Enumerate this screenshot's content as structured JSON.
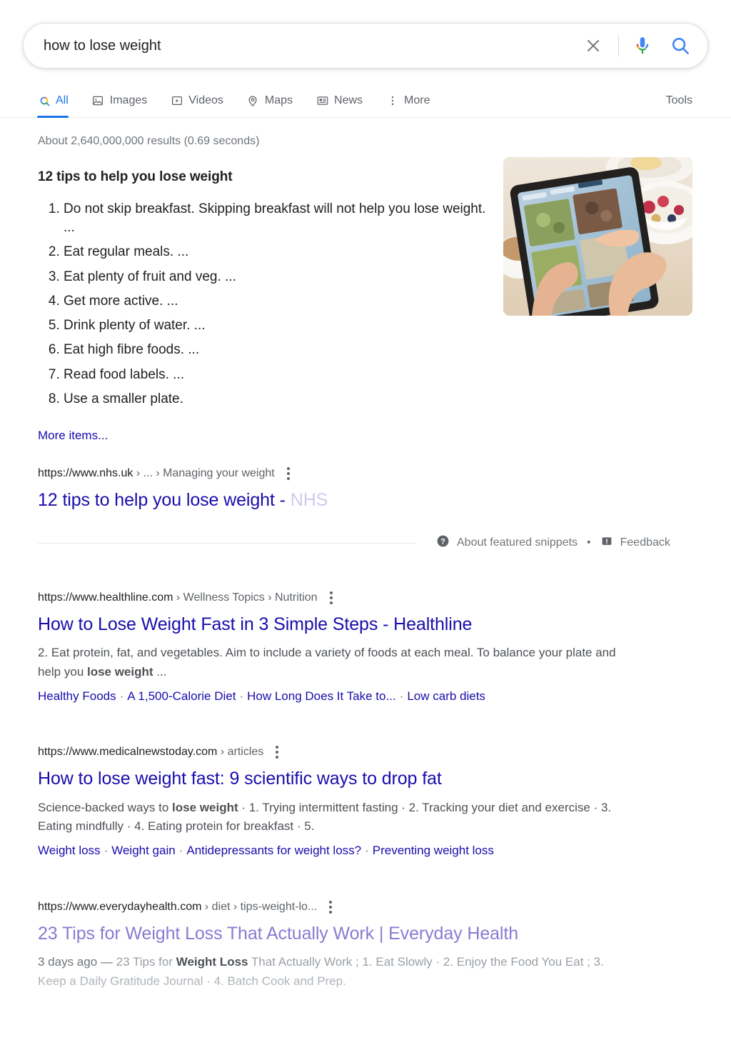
{
  "search": {
    "query": "how to lose weight",
    "placeholder": "Search",
    "clear_label": "Clear",
    "mic_label": "Search by voice",
    "search_label": "Google Search"
  },
  "nav": {
    "tabs": [
      {
        "label": "All",
        "icon": "google-search-icon",
        "active": true
      },
      {
        "label": "Images",
        "icon": "image-icon",
        "active": false
      },
      {
        "label": "Videos",
        "icon": "video-icon",
        "active": false
      },
      {
        "label": "Maps",
        "icon": "map-pin-icon",
        "active": false
      },
      {
        "label": "News",
        "icon": "news-icon",
        "active": false
      },
      {
        "label": "More",
        "icon": "kebab-icon",
        "active": false
      }
    ],
    "tools_label": "Tools"
  },
  "result_stats": "About 2,640,000,000 results (0.69 seconds)",
  "featured_snippet": {
    "heading": "12 tips to help you lose weight",
    "items": [
      "Do not skip breakfast. Skipping breakfast will not help you lose weight. ...",
      "Eat regular meals. ...",
      "Eat plenty of fruit and veg. ...",
      "Get more active. ...",
      "Drink plenty of water. ...",
      "Eat high fibre foods. ...",
      "Read food labels. ...",
      "Use a smaller plate."
    ],
    "more_items_label": "More items...",
    "source": {
      "domain": "https://www.nhs.uk",
      "crumbs": "› ... › Managing your weight",
      "title_visible": "12 tips to help you lose weight - ",
      "title_faded": "NHS"
    },
    "thumbnail_alt": "hands-using-tablet-with-meal-photos",
    "footer": {
      "about_label": "About featured snippets",
      "separator": "•",
      "feedback_label": "Feedback"
    }
  },
  "results": [
    {
      "domain": "https://www.healthline.com",
      "crumbs": "› Wellness Topics › Nutrition",
      "title": "How to Lose Weight Fast in 3 Simple Steps - Healthline",
      "snippet_pre": "2. Eat protein, fat, and vegetables. Aim to include a variety of foods at each meal. To balance your plate and help you ",
      "snippet_bold": "lose weight",
      "snippet_post": " ...",
      "sitelinks": [
        "Healthy Foods",
        "A 1,500-Calorie Diet",
        "How Long Does It Take to...",
        "Low carb diets"
      ],
      "visited": false,
      "faded": false
    },
    {
      "domain": "https://www.medicalnewstoday.com",
      "crumbs": "› articles",
      "title": "How to lose weight fast: 9 scientific ways to drop fat",
      "snippet_pre": "Science-backed ways to ",
      "snippet_bold": "lose weight",
      "snippet_post": " · 1. Trying intermittent fasting · 2. Tracking your diet and exercise · 3. Eating mindfully · 4. Eating protein for breakfast · 5.",
      "sitelinks": [
        "Weight loss",
        "Weight gain",
        "Antidepressants for weight loss?",
        "Preventing weight loss"
      ],
      "visited": false,
      "faded": false
    },
    {
      "domain": "https://www.everydayhealth.com",
      "crumbs": "› diet › tips-weight-lo...",
      "title": "23 Tips for Weight Loss That Actually Work | Everyday Health",
      "snippet_date": "3 days ago — ",
      "snippet_pre": "23 Tips for ",
      "snippet_bold": "Weight Loss",
      "snippet_post": " That Actually Work ; 1. Eat Slowly · 2. Enjoy the Food You Eat ; 3. Keep a Daily Gratitude Journal · 4. Batch Cook and Prep.",
      "sitelinks": [],
      "visited": true,
      "faded": true
    }
  ],
  "colors": {
    "link": "#1a0dab",
    "visited_link": "#6c43bf",
    "accent_blue": "#1a73e8",
    "google_red": "#ea4335",
    "google_yellow": "#fbbc04",
    "google_green": "#34a853",
    "text": "#202124",
    "muted": "#70757a"
  }
}
